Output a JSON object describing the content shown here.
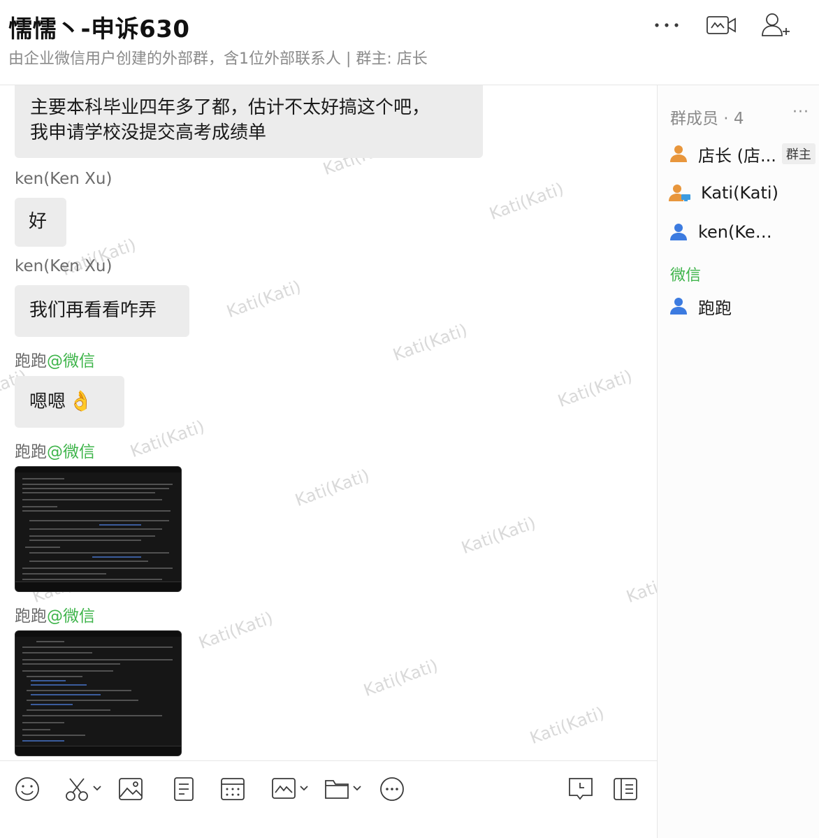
{
  "header": {
    "title": "懦懦丶-申诉630",
    "subtitle": "由企业微信用户创建的外部群，含1位外部联系人 | 群主: 店长"
  },
  "messages": [
    {
      "type": "text",
      "lines": [
        "主要本科毕业四年多了都，估计不太好搞这个吧，",
        "我申请学校没提交高考成绩单"
      ]
    },
    {
      "type": "sender",
      "name": "ken(Ken Xu)"
    },
    {
      "type": "text",
      "text": "好"
    },
    {
      "type": "sender",
      "name": "ken(Ken Xu)"
    },
    {
      "type": "text",
      "text": "我们再看看咋弄"
    },
    {
      "type": "sender",
      "name": "跑跑",
      "source": "@微信"
    },
    {
      "type": "text",
      "text": "嗯嗯",
      "emoji": "👌"
    },
    {
      "type": "sender",
      "name": "跑跑",
      "source": "@微信"
    },
    {
      "type": "image"
    },
    {
      "type": "sender",
      "name": "跑跑",
      "source": "@微信"
    },
    {
      "type": "image"
    }
  ],
  "watermark": "Kati(Kati)",
  "panel": {
    "title": "群成员 · 4",
    "more": "···",
    "members": [
      {
        "name": "店长 (店...",
        "badge": "群主",
        "icon": "user-orange-icon",
        "color": "#e8963c"
      },
      {
        "name": "Kati(Kati)",
        "icon": "user-computer-icon",
        "color": "#e8963c"
      },
      {
        "name": "ken(Ken Xu)",
        "icon": "user-blue-icon",
        "color": "#3c7be0"
      }
    ],
    "wechat_section": "微信",
    "wechat_members": [
      {
        "name": "跑跑",
        "icon": "user-blue-icon",
        "color": "#3c7be0"
      }
    ]
  },
  "colors": {
    "accent_green": "#3eb44a",
    "bubble": "#ececec"
  }
}
